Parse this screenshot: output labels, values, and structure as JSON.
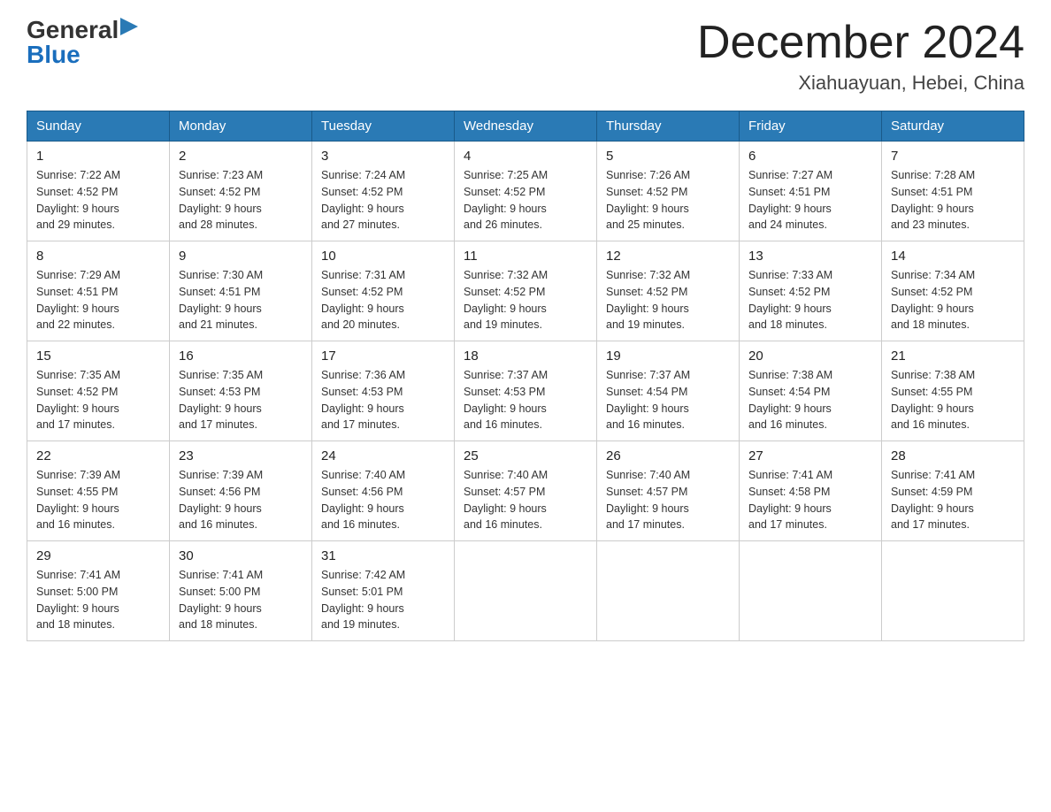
{
  "logo": {
    "general": "General",
    "blue": "Blue"
  },
  "header": {
    "month": "December 2024",
    "location": "Xiahuayuan, Hebei, China"
  },
  "days_of_week": [
    "Sunday",
    "Monday",
    "Tuesday",
    "Wednesday",
    "Thursday",
    "Friday",
    "Saturday"
  ],
  "weeks": [
    [
      {
        "day": "1",
        "sunrise": "7:22 AM",
        "sunset": "4:52 PM",
        "daylight": "9 hours and 29 minutes."
      },
      {
        "day": "2",
        "sunrise": "7:23 AM",
        "sunset": "4:52 PM",
        "daylight": "9 hours and 28 minutes."
      },
      {
        "day": "3",
        "sunrise": "7:24 AM",
        "sunset": "4:52 PM",
        "daylight": "9 hours and 27 minutes."
      },
      {
        "day": "4",
        "sunrise": "7:25 AM",
        "sunset": "4:52 PM",
        "daylight": "9 hours and 26 minutes."
      },
      {
        "day": "5",
        "sunrise": "7:26 AM",
        "sunset": "4:52 PM",
        "daylight": "9 hours and 25 minutes."
      },
      {
        "day": "6",
        "sunrise": "7:27 AM",
        "sunset": "4:51 PM",
        "daylight": "9 hours and 24 minutes."
      },
      {
        "day": "7",
        "sunrise": "7:28 AM",
        "sunset": "4:51 PM",
        "daylight": "9 hours and 23 minutes."
      }
    ],
    [
      {
        "day": "8",
        "sunrise": "7:29 AM",
        "sunset": "4:51 PM",
        "daylight": "9 hours and 22 minutes."
      },
      {
        "day": "9",
        "sunrise": "7:30 AM",
        "sunset": "4:51 PM",
        "daylight": "9 hours and 21 minutes."
      },
      {
        "day": "10",
        "sunrise": "7:31 AM",
        "sunset": "4:52 PM",
        "daylight": "9 hours and 20 minutes."
      },
      {
        "day": "11",
        "sunrise": "7:32 AM",
        "sunset": "4:52 PM",
        "daylight": "9 hours and 19 minutes."
      },
      {
        "day": "12",
        "sunrise": "7:32 AM",
        "sunset": "4:52 PM",
        "daylight": "9 hours and 19 minutes."
      },
      {
        "day": "13",
        "sunrise": "7:33 AM",
        "sunset": "4:52 PM",
        "daylight": "9 hours and 18 minutes."
      },
      {
        "day": "14",
        "sunrise": "7:34 AM",
        "sunset": "4:52 PM",
        "daylight": "9 hours and 18 minutes."
      }
    ],
    [
      {
        "day": "15",
        "sunrise": "7:35 AM",
        "sunset": "4:52 PM",
        "daylight": "9 hours and 17 minutes."
      },
      {
        "day": "16",
        "sunrise": "7:35 AM",
        "sunset": "4:53 PM",
        "daylight": "9 hours and 17 minutes."
      },
      {
        "day": "17",
        "sunrise": "7:36 AM",
        "sunset": "4:53 PM",
        "daylight": "9 hours and 17 minutes."
      },
      {
        "day": "18",
        "sunrise": "7:37 AM",
        "sunset": "4:53 PM",
        "daylight": "9 hours and 16 minutes."
      },
      {
        "day": "19",
        "sunrise": "7:37 AM",
        "sunset": "4:54 PM",
        "daylight": "9 hours and 16 minutes."
      },
      {
        "day": "20",
        "sunrise": "7:38 AM",
        "sunset": "4:54 PM",
        "daylight": "9 hours and 16 minutes."
      },
      {
        "day": "21",
        "sunrise": "7:38 AM",
        "sunset": "4:55 PM",
        "daylight": "9 hours and 16 minutes."
      }
    ],
    [
      {
        "day": "22",
        "sunrise": "7:39 AM",
        "sunset": "4:55 PM",
        "daylight": "9 hours and 16 minutes."
      },
      {
        "day": "23",
        "sunrise": "7:39 AM",
        "sunset": "4:56 PM",
        "daylight": "9 hours and 16 minutes."
      },
      {
        "day": "24",
        "sunrise": "7:40 AM",
        "sunset": "4:56 PM",
        "daylight": "9 hours and 16 minutes."
      },
      {
        "day": "25",
        "sunrise": "7:40 AM",
        "sunset": "4:57 PM",
        "daylight": "9 hours and 16 minutes."
      },
      {
        "day": "26",
        "sunrise": "7:40 AM",
        "sunset": "4:57 PM",
        "daylight": "9 hours and 17 minutes."
      },
      {
        "day": "27",
        "sunrise": "7:41 AM",
        "sunset": "4:58 PM",
        "daylight": "9 hours and 17 minutes."
      },
      {
        "day": "28",
        "sunrise": "7:41 AM",
        "sunset": "4:59 PM",
        "daylight": "9 hours and 17 minutes."
      }
    ],
    [
      {
        "day": "29",
        "sunrise": "7:41 AM",
        "sunset": "5:00 PM",
        "daylight": "9 hours and 18 minutes."
      },
      {
        "day": "30",
        "sunrise": "7:41 AM",
        "sunset": "5:00 PM",
        "daylight": "9 hours and 18 minutes."
      },
      {
        "day": "31",
        "sunrise": "7:42 AM",
        "sunset": "5:01 PM",
        "daylight": "9 hours and 19 minutes."
      },
      null,
      null,
      null,
      null
    ]
  ],
  "labels": {
    "sunrise": "Sunrise:",
    "sunset": "Sunset:",
    "daylight": "Daylight:"
  }
}
